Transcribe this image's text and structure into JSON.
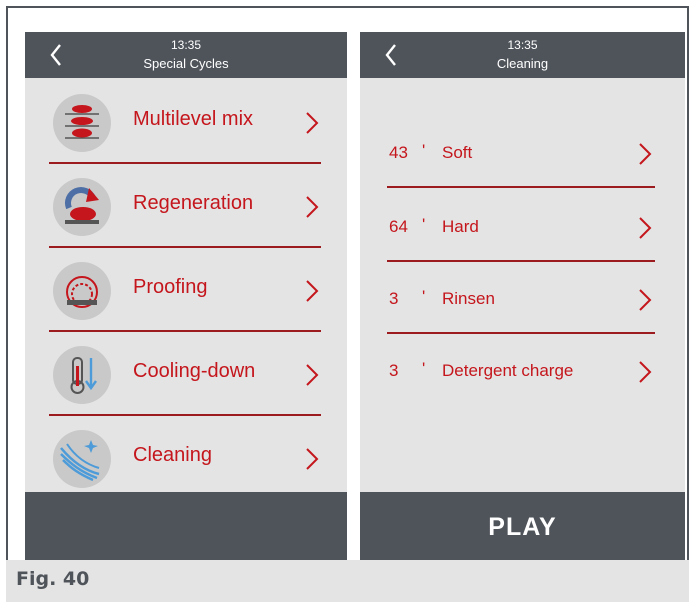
{
  "left_screen": {
    "time": "13:35",
    "title": "Special Cycles",
    "items": [
      {
        "label": "Multilevel mix",
        "icon": "multilevel-icon"
      },
      {
        "label": "Regeneration",
        "icon": "regeneration-icon"
      },
      {
        "label": "Proofing",
        "icon": "proofing-icon"
      },
      {
        "label": "Cooling-down",
        "icon": "cooling-down-icon"
      },
      {
        "label": "Cleaning",
        "icon": "cleaning-icon"
      }
    ]
  },
  "right_screen": {
    "time": "13:35",
    "title": "Cleaning",
    "items": [
      {
        "minutes": "43",
        "mark": "'",
        "label": "Soft"
      },
      {
        "minutes": "64",
        "mark": "'",
        "label": "Hard"
      },
      {
        "minutes": "3",
        "mark": "'",
        "label": "Rinsen"
      },
      {
        "minutes": "3",
        "mark": "'",
        "label": "Detergent charge"
      }
    ],
    "play_label": "PLAY"
  },
  "caption": "Fig. 40",
  "colors": {
    "header": "#4f545b",
    "panel": "#e4e4e4",
    "accent": "#c4161c"
  }
}
